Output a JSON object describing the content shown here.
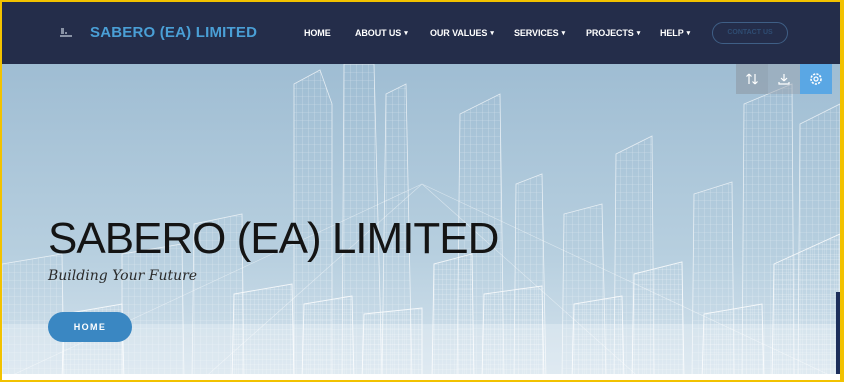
{
  "brand": {
    "name": "SABERO (EA) LIMITED"
  },
  "nav": {
    "items": [
      {
        "label": "HOME",
        "dropdown": false
      },
      {
        "label": "ABOUT US",
        "dropdown": true
      },
      {
        "label": "OUR VALUES",
        "dropdown": true
      },
      {
        "label": "SERVICES",
        "dropdown": true
      },
      {
        "label": "PROJECTS",
        "dropdown": true
      },
      {
        "label": "HELP",
        "dropdown": true
      }
    ],
    "contact_label": "CONTACT US",
    "caret": "▾"
  },
  "toolbar": {
    "icons": [
      "sort-arrows-icon",
      "download-icon",
      "gear-icon"
    ]
  },
  "hero": {
    "title": "SABERO (EA) LIMITED",
    "subtitle": "Building Your Future",
    "button_label": "HOME"
  },
  "colors": {
    "navbar": "#242d4a",
    "brand": "#4a9fd6",
    "hero_bg": "#a9c4d8",
    "button": "#3a87c2",
    "border": "#f2c200"
  }
}
